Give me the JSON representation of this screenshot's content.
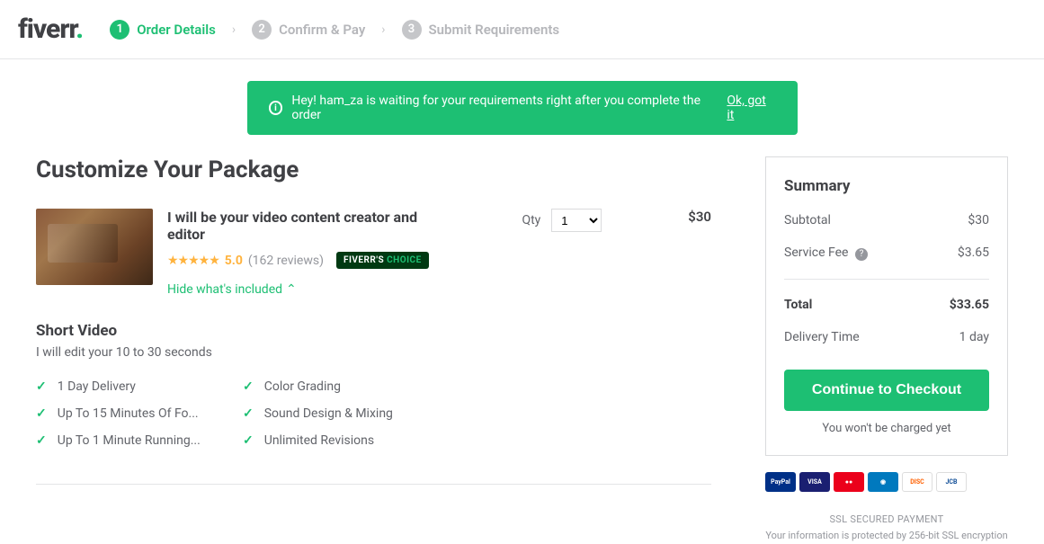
{
  "logo": "fiverr",
  "steps": [
    {
      "num": "1",
      "label": "Order Details"
    },
    {
      "num": "2",
      "label": "Confirm & Pay"
    },
    {
      "num": "3",
      "label": "Submit Requirements"
    }
  ],
  "notice": {
    "text": "Hey! ham_za is waiting for your requirements right after you complete the order",
    "dismiss": "Ok, got it"
  },
  "page_title": "Customize Your Package",
  "gig": {
    "title": "I will be your video content creator and editor",
    "rating": "5.0",
    "reviews": "(162 reviews)",
    "badge_prefix": "FIVERR'S",
    "badge_suffix": "CHOICE",
    "toggle": "Hide what's included",
    "qty_label": "Qty",
    "qty_value": "1",
    "price": "$30"
  },
  "package": {
    "name": "Short Video",
    "desc": "I will edit your 10 to 30 seconds",
    "features": [
      "1 Day Delivery",
      "Color Grading",
      "Up To 15 Minutes Of Fo...",
      "Sound Design & Mixing",
      "Up To 1 Minute Running...",
      "Unlimited Revisions"
    ]
  },
  "summary": {
    "title": "Summary",
    "subtotal_label": "Subtotal",
    "subtotal_value": "$30",
    "fee_label": "Service Fee",
    "fee_value": "$3.65",
    "total_label": "Total",
    "total_value": "$33.65",
    "delivery_label": "Delivery Time",
    "delivery_value": "1 day",
    "checkout": "Continue to Checkout",
    "charge_note": "You won't be charged yet"
  },
  "ssl": {
    "title": "SSL SECURED PAYMENT",
    "desc": "Your information is protected by 256-bit SSL encryption"
  }
}
